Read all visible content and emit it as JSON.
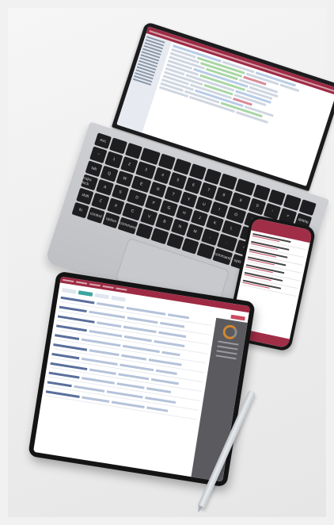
{
  "scene": "devices",
  "laptop": {
    "keys": [
      "esc",
      "",
      "",
      "",
      "",
      "",
      "",
      "",
      "",
      "",
      "",
      "",
      "",
      "",
      "~",
      "1",
      "2",
      "3",
      "4",
      "5",
      "6",
      "7",
      "8",
      "9",
      "0",
      "-",
      "=",
      "delete",
      "tab",
      "Q",
      "W",
      "E",
      "R",
      "T",
      "Y",
      "U",
      "I",
      "O",
      "P",
      "[",
      "]",
      "\\",
      "caps lock",
      "A",
      "S",
      "D",
      "F",
      "G",
      "H",
      "J",
      "K",
      "L",
      ";",
      "'",
      "return",
      "",
      "shift",
      "Z",
      "X",
      "C",
      "V",
      "B",
      "N",
      "M",
      ",",
      ".",
      "/",
      "shift",
      "",
      "",
      "fn",
      "control",
      "option",
      "command",
      "",
      "",
      "",
      "",
      "",
      "command",
      "option",
      "",
      "",
      ""
    ]
  },
  "colors": {
    "accent_crimson": "#9e2a43",
    "accent_teal": "#3aa6a0",
    "panel_gray": "#5b5b5f",
    "device_black": "#161617",
    "laptop_silver": "#c8c9cd",
    "background": "#f1f1f1"
  }
}
